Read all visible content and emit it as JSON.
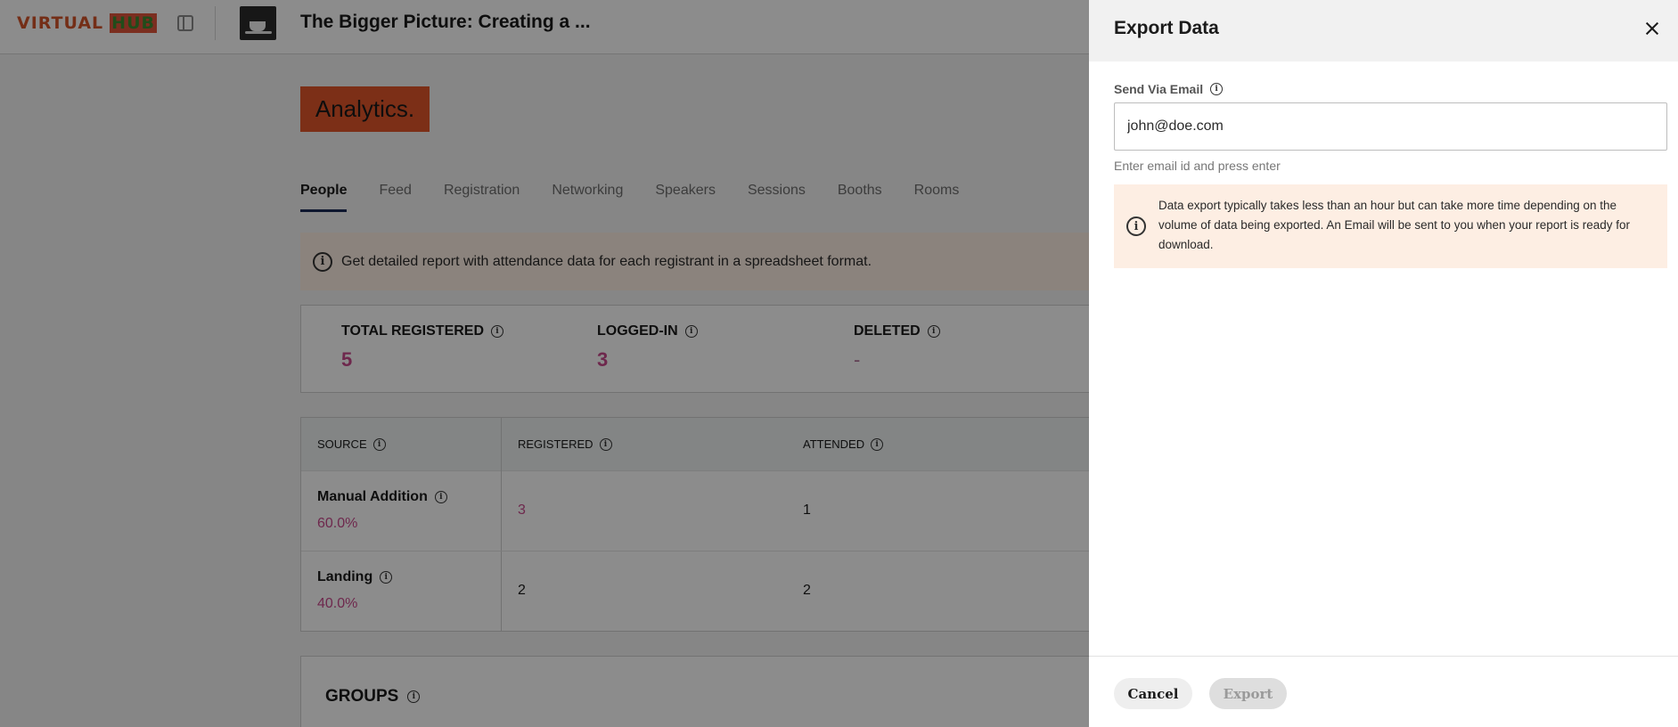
{
  "header": {
    "logo_text": "VIRTUAL",
    "logo_suffix": "HUB",
    "event_title": "The Bigger Picture: Creating a ..."
  },
  "page": {
    "badge": "Analytics.",
    "tabs": [
      "People",
      "Feed",
      "Registration",
      "Networking",
      "Speakers",
      "Sessions",
      "Booths",
      "Rooms"
    ],
    "active_tab": "People",
    "info_text": "Get detailed report with attendance data for each registrant in a spreadsheet format."
  },
  "stats": [
    {
      "label": "TOTAL REGISTERED",
      "value": "5"
    },
    {
      "label": "LOGGED-IN",
      "value": "3"
    },
    {
      "label": "DELETED",
      "value": "-"
    }
  ],
  "table": {
    "headers": [
      "SOURCE",
      "REGISTERED",
      "ATTENDED"
    ],
    "rows": [
      {
        "source": "Manual Addition",
        "pct": "60.0%",
        "registered": "3",
        "attended": "1"
      },
      {
        "source": "Landing",
        "pct": "40.0%",
        "registered": "2",
        "attended": "2"
      }
    ]
  },
  "groups": {
    "title": "GROUPS"
  },
  "drawer": {
    "title": "Export Data",
    "email_label": "Send Via Email",
    "email_value": "john@doe.com",
    "email_help": "Enter email id and press enter",
    "notice": "Data export typically takes less than an hour but can take more time depending on the volume of data being exported. An Email will be sent to you when your report is ready for download.",
    "cancel_label": "Cancel",
    "export_label": "Export"
  },
  "colors": {
    "accent": "#e2572a",
    "stat_value": "#c94a8c",
    "banner_bg": "#fdeee3",
    "tab_indicator": "#1b2a57"
  }
}
